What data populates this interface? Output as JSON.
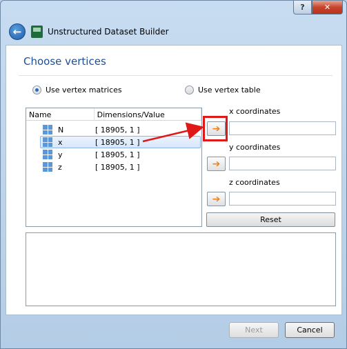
{
  "window": {
    "title_help": "?",
    "title_close": "✕",
    "app_title": "Unstructured Dataset Builder"
  },
  "page": {
    "heading": "Choose vertices",
    "radio_matrices": "Use vertex matrices",
    "radio_table": "Use vertex table",
    "selected_option": "matrices"
  },
  "list": {
    "col_name": "Name",
    "col_dim": "Dimensions/Value",
    "rows": [
      {
        "name": "N",
        "dim": "[ 18905, 1 ]"
      },
      {
        "name": "x",
        "dim": "[ 18905, 1 ]"
      },
      {
        "name": "y",
        "dim": "[ 18905, 1 ]"
      },
      {
        "name": "z",
        "dim": "[ 18905, 1 ]"
      }
    ],
    "selected_index": 1
  },
  "coords": {
    "x_label": "x coordinates",
    "y_label": "y coordinates",
    "z_label": "z coordinates",
    "x_value": "",
    "y_value": "",
    "z_value": "",
    "reset_label": "Reset"
  },
  "footer": {
    "next_label": "Next",
    "cancel_label": "Cancel"
  },
  "colors": {
    "accent": "#1e4e96",
    "annotation": "#e01818",
    "arrow": "#f0821e"
  }
}
